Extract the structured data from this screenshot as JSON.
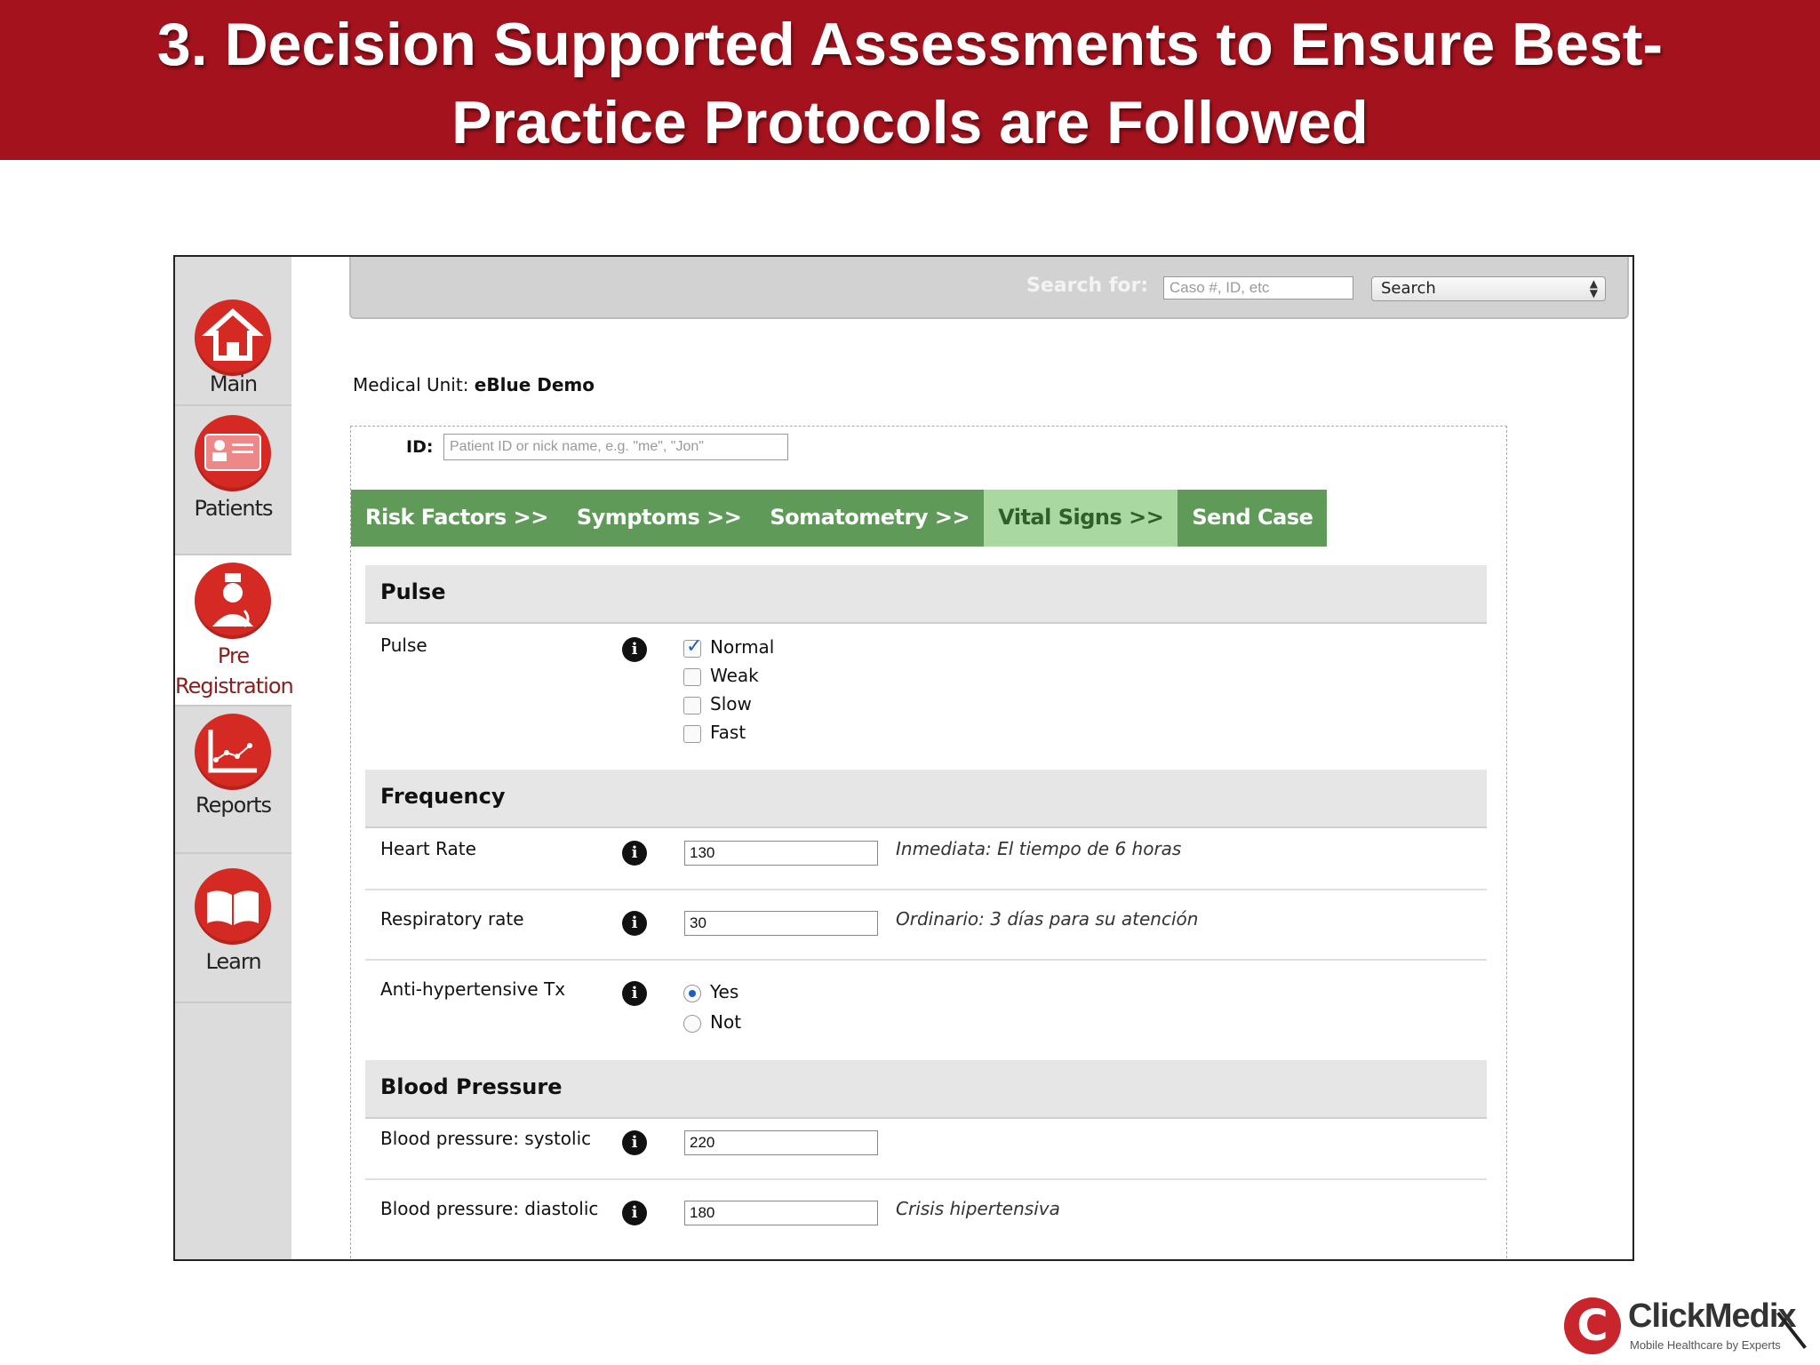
{
  "slide": {
    "title_line1": "3. Decision Supported Assessments to Ensure Best-",
    "title_line2": "Practice Protocols are Followed"
  },
  "colors": {
    "header_red": "#a4121d",
    "nav_icon_red": "#d42a23",
    "tab_green": "#5f9a59",
    "tab_active": "#a9d9a1",
    "check_blue": "#1b5fc2"
  },
  "sidebar": {
    "items": [
      {
        "label": "Main",
        "icon": "home-icon",
        "active": false
      },
      {
        "label": "Patients",
        "icon": "patient-card-icon",
        "active": false
      },
      {
        "label_line1": "Pre",
        "label_line2": "Registration",
        "icon": "nurse-icon",
        "active": true
      },
      {
        "label": "Reports",
        "icon": "chart-icon",
        "active": false
      },
      {
        "label": "Learn",
        "icon": "book-icon",
        "active": false
      }
    ]
  },
  "search": {
    "label": "Search for:",
    "placeholder": "Caso #, ID, etc",
    "select_value": "Search"
  },
  "medical_unit": {
    "label": "Medical Unit:",
    "value": "eBlue Demo"
  },
  "patient_id": {
    "label": "ID:",
    "placeholder": "Patient ID or nick name, e.g. \"me\", \"Jon\""
  },
  "tabs": [
    {
      "label": "Risk Factors >>",
      "active": false
    },
    {
      "label": "Symptoms >>",
      "active": false
    },
    {
      "label": "Somatometry >>",
      "active": false
    },
    {
      "label": "Vital Signs >>",
      "active": true
    },
    {
      "label": "Send Case",
      "active": false
    }
  ],
  "pulse_section": {
    "title": "Pulse",
    "row_label": "Pulse",
    "options": [
      {
        "label": "Normal",
        "checked": true
      },
      {
        "label": "Weak",
        "checked": false
      },
      {
        "label": "Slow",
        "checked": false
      },
      {
        "label": "Fast",
        "checked": false
      }
    ]
  },
  "frequency_section": {
    "title": "Frequency",
    "heart_rate": {
      "label": "Heart Rate",
      "value": "130",
      "note": "Inmediata: El tiempo de 6 horas"
    },
    "respiratory_rate": {
      "label": "Respiratory rate",
      "value": "30",
      "note": "Ordinario: 3 días para su atención"
    },
    "antihypertensive": {
      "label": "Anti-hypertensive Tx",
      "options": [
        {
          "label": "Yes",
          "selected": true
        },
        {
          "label": "Not",
          "selected": false
        }
      ]
    }
  },
  "blood_pressure_section": {
    "title": "Blood Pressure",
    "systolic": {
      "label": "Blood pressure: systolic",
      "value": "220"
    },
    "diastolic": {
      "label": "Blood pressure: diastolic",
      "value": "180",
      "note": "Crisis hipertensiva"
    }
  },
  "logo": {
    "mark": "C",
    "name": "ClickMedix",
    "tagline": "Mobile Healthcare by Experts"
  }
}
